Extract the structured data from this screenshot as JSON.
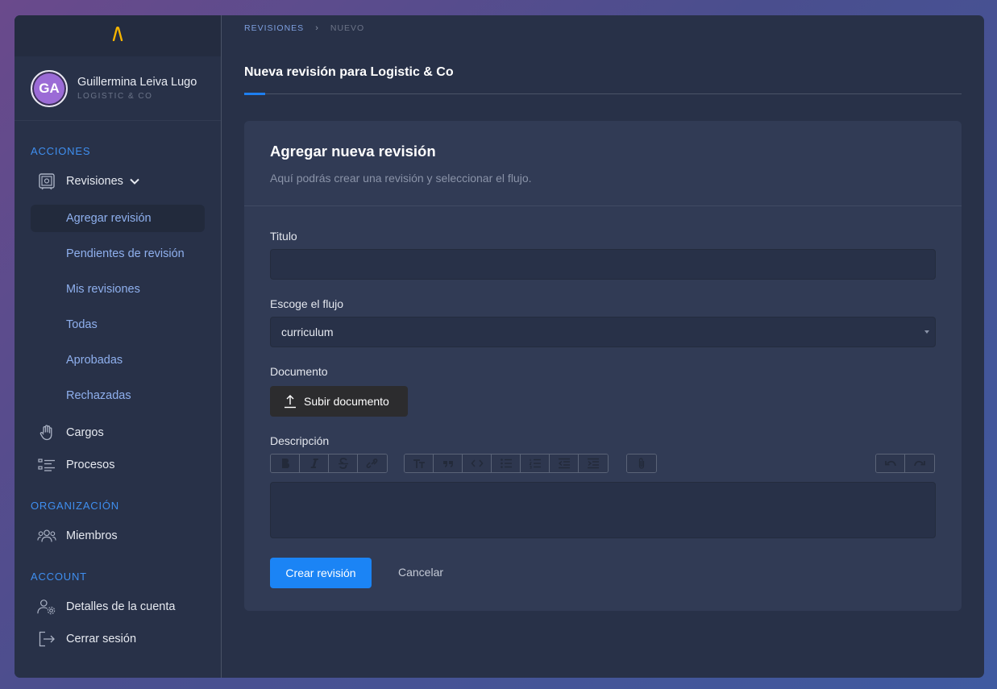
{
  "sidebar": {
    "user": {
      "initials": "GA",
      "name": "Guillermina Leiva Lugo",
      "org": "LOGISTIC & CO"
    },
    "sections": {
      "acciones": "ACCIONES",
      "organizacion": "ORGANIZACIÓN",
      "account": "ACCOUNT"
    },
    "revisiones": {
      "label": "Revisiones",
      "subitems": [
        "Agregar revisión",
        "Pendientes de revisión",
        "Mis revisiones",
        "Todas",
        "Aprobadas",
        "Rechazadas"
      ]
    },
    "items": {
      "cargos": "Cargos",
      "procesos": "Procesos",
      "miembros": "Miembros",
      "detalles": "Detalles de la cuenta",
      "cerrar": "Cerrar sesión"
    }
  },
  "breadcrumb": {
    "parent": "REVISIONES",
    "separator": "›",
    "current": "NUEVO"
  },
  "page": {
    "title": "Nueva revisión para Logistic & Co"
  },
  "card": {
    "title": "Agregar nueva revisión",
    "subtitle": "Aquí podrás crear una revisión y seleccionar el flujo.",
    "fields": {
      "titulo_label": "Titulo",
      "titulo_value": "",
      "flujo_label": "Escoge el flujo",
      "flujo_value": "curriculum",
      "documento_label": "Documento",
      "upload_label": "Subir documento",
      "descripcion_label": "Descripción"
    },
    "toolbar_icons": [
      [
        "bold-icon",
        "italic-icon",
        "strikethrough-icon",
        "link-icon"
      ],
      [
        "heading-icon",
        "quote-icon",
        "code-icon",
        "bullet-list-icon",
        "numbered-list-icon",
        "outdent-icon",
        "indent-icon"
      ],
      [
        "attachment-icon"
      ],
      [
        "undo-icon",
        "redo-icon"
      ]
    ],
    "actions": {
      "create": "Crear revisión",
      "cancel": "Cancelar"
    }
  },
  "colors": {
    "accent": "#1b84f5",
    "section_title": "#3f8ff0",
    "sublink": "#8fb0ee",
    "logo": "#f5b400",
    "avatar": "#9b6bd6"
  }
}
